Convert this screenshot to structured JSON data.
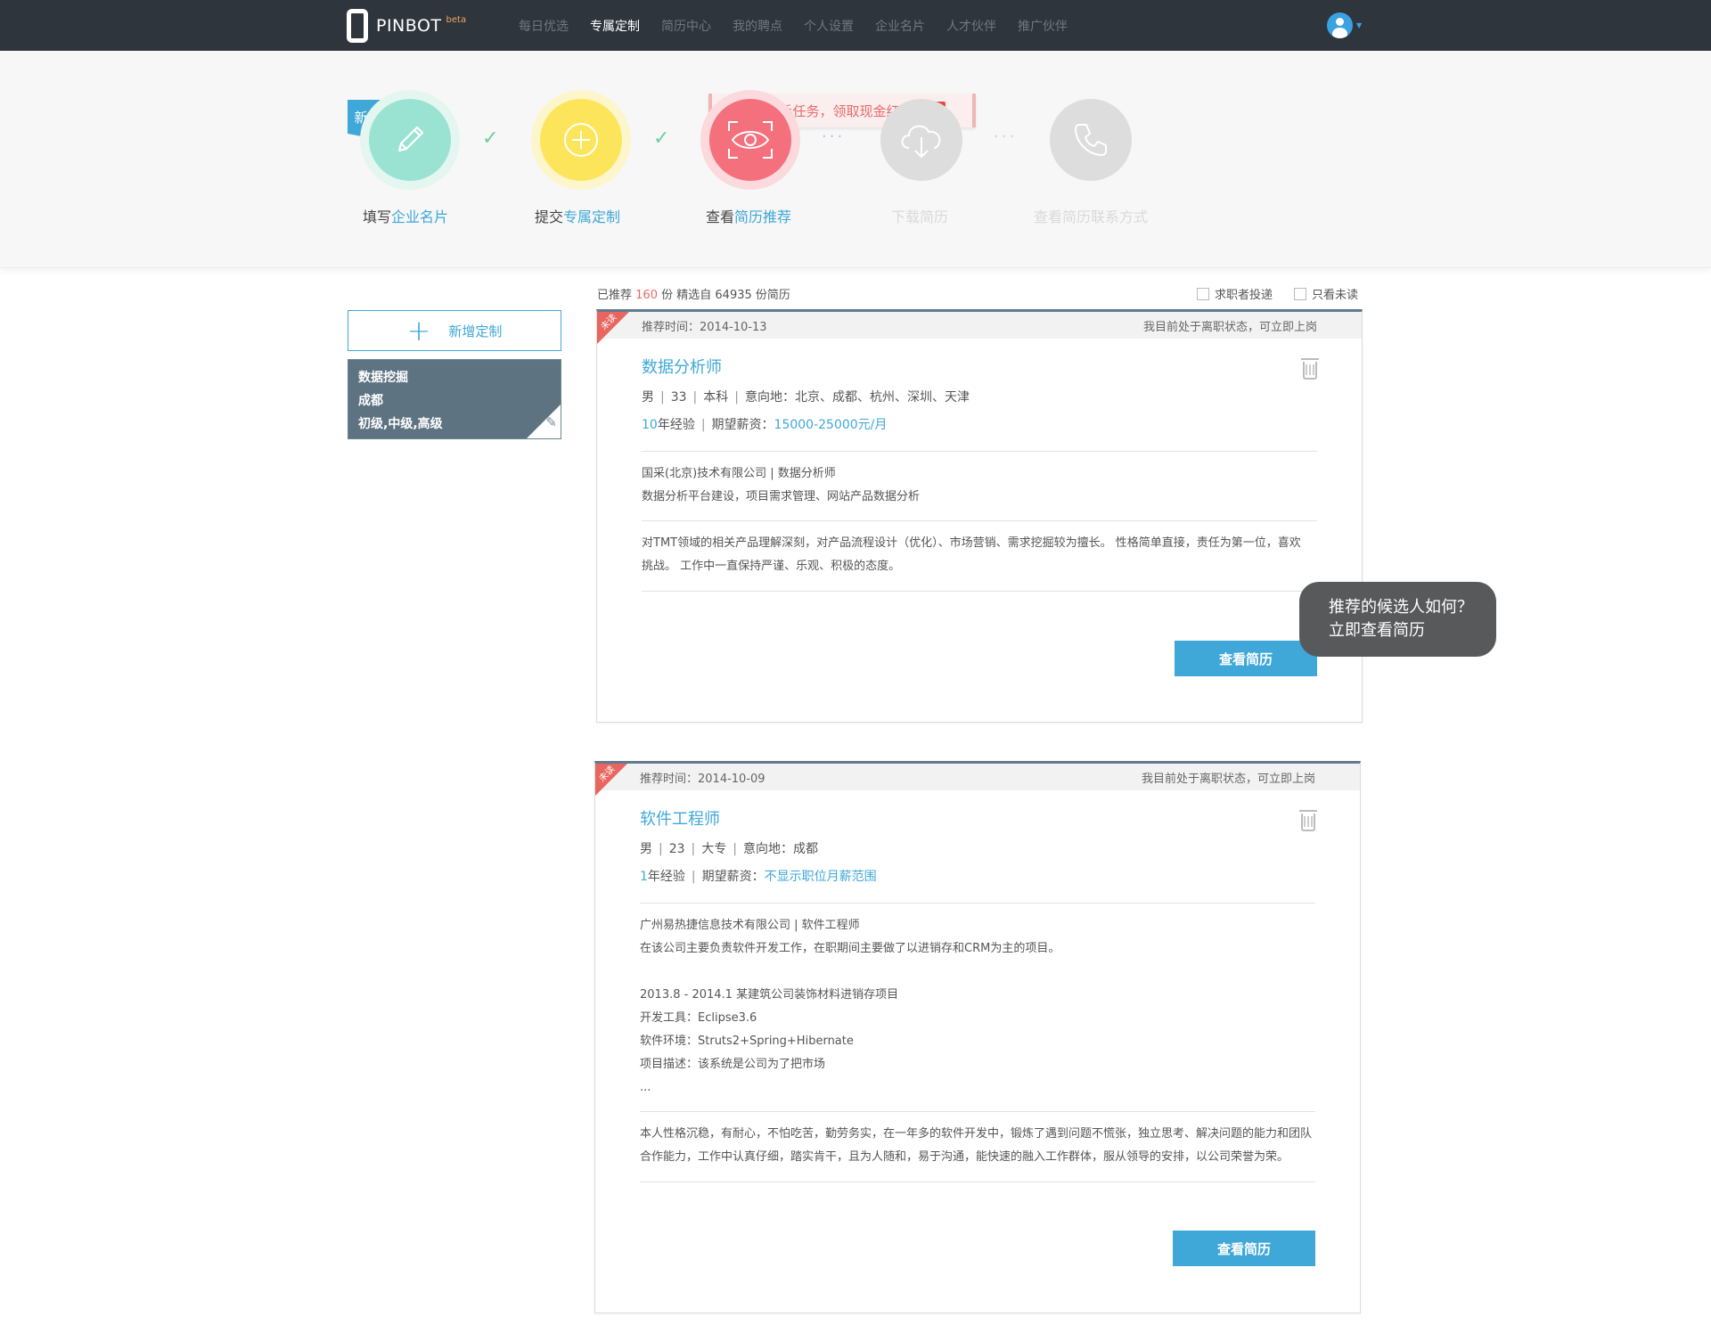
{
  "app": {
    "name": "PINBOT",
    "badge": "beta"
  },
  "nav": {
    "items": [
      "每日优选",
      "专属定制",
      "简历中心",
      "我的聘点",
      "个人设置",
      "企业名片",
      "人才伙伴",
      "推广伙伴"
    ],
    "active": "专属定制"
  },
  "guide": {
    "flag": "新手引导",
    "task_banner": "完成新手任务，领取现金红包",
    "steps": [
      {
        "pre": "填写",
        "hl": "企业名片",
        "color": "#9ae3d3",
        "state": "done",
        "icon": "pencil-icon"
      },
      {
        "pre": "提交",
        "hl": "专属定制",
        "color": "#fde55b",
        "state": "done",
        "icon": "plus-circle-icon"
      },
      {
        "pre": "查看",
        "hl": "简历推荐",
        "color": "#f4707c",
        "state": "current",
        "icon": "eye-scan-icon"
      },
      {
        "pre": "下载简历",
        "hl": "",
        "color": "#dddddd",
        "state": "todo",
        "icon": "cloud-download-icon"
      },
      {
        "pre": "查看简历联系方式",
        "hl": "",
        "color": "#dddddd",
        "state": "todo",
        "icon": "phone-icon"
      }
    ]
  },
  "sidebar": {
    "add_label": "新增定制",
    "custom": {
      "line1": "数据挖掘",
      "line2": "成都",
      "line3": "初级,中级,高级"
    }
  },
  "summary": {
    "pre": "已推荐",
    "count": "160",
    "mid": "份 精选自",
    "total": "64935",
    "post": "份简历"
  },
  "filters": {
    "applicant": "求职者投递",
    "unread": "只看未读"
  },
  "tooltip": {
    "line1": "推荐的候选人如何？",
    "line2": "立即查看简历"
  },
  "cards": [
    {
      "ribbon": "未读",
      "date_label": "推荐时间：",
      "date": "2014-10-13",
      "status": "我目前处于离职状态，可立即上岗",
      "title": "数据分析师",
      "gender": "男",
      "age": "33",
      "edu": "本科",
      "location_label": "意向地：",
      "location": "北京、成都、杭州、深圳、天津",
      "exp_num": "10",
      "exp_text": "年经验",
      "salary_label": "期望薪资：",
      "salary": "15000-25000元/月",
      "company": "国采(北京)技术有限公司 | 数据分析师",
      "duties": "数据分析平台建设，项目需求管理、网站产品数据分析",
      "summary_line1": "对TMT领域的相关产品理解深刻，对产品流程设计（优化）、市场营销、需求挖掘较为擅长。 性格简单直接，责任为第一位，喜欢",
      "summary_line2": "挑战。 工作中一直保持严谨、乐观、积极的态度。",
      "button": "查看简历"
    },
    {
      "ribbon": "未读",
      "date_label": "推荐时间：",
      "date": "2014-10-09",
      "status": "我目前处于离职状态，可立即上岗",
      "title": "软件工程师",
      "gender": "男",
      "age": "23",
      "edu": "大专",
      "location_label": "意向地：",
      "location": "成都",
      "exp_num": "1",
      "exp_text": "年经验",
      "salary_label": "期望薪资：",
      "salary": "不显示职位月薪范围",
      "company": "广州易热捷信息技术有限公司 | 软件工程师",
      "duties": "在该公司主要负责软件开发工作，在职期间主要做了以进销存和CRM为主的项目。",
      "project_line1": "2013.8  -  2014.1 某建筑公司装饰材料进销存项目",
      "project_line2": "开发工具：Eclipse3.6",
      "project_line3": "软件环境：Struts2+Spring+Hibernate",
      "project_line4": "项目描述：该系统是公司为了把市场",
      "project_line5": "...",
      "summary_line1": "本人性格沉稳，有耐心，不怕吃苦，勤劳务实，在一年多的软件开发中，锻炼了遇到问题不慌张，独立思考、解决问题的能力和团队",
      "summary_line2": "合作能力，工作中认真仔细，踏实肯干，且为人随和，易于沟通，能快速的融入工作群体，服从领导的安排，以公司荣誉为荣。",
      "button": "查看简历"
    }
  ]
}
